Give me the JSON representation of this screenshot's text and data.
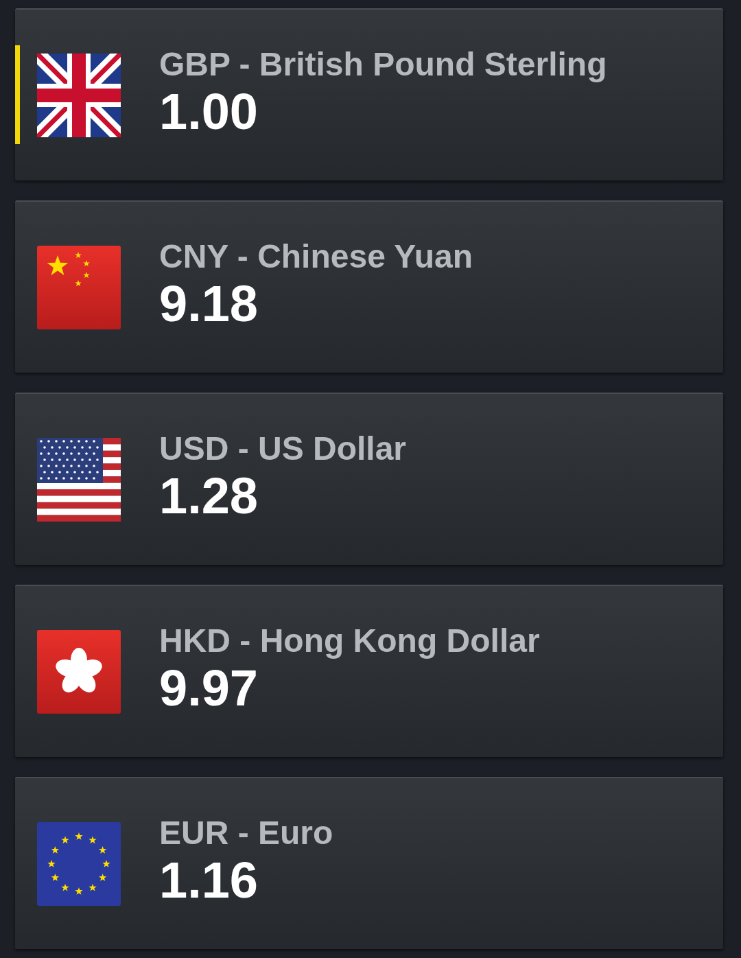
{
  "currencies": [
    {
      "kind": "uk",
      "name": "GBP - British Pound Sterling",
      "value": "1.00",
      "selected": true
    },
    {
      "kind": "china",
      "name": "CNY - Chinese Yuan",
      "value": "9.18",
      "selected": false
    },
    {
      "kind": "usa",
      "name": "USD - US Dollar",
      "value": "1.28",
      "selected": false
    },
    {
      "kind": "hongkong",
      "name": "HKD - Hong Kong Dollar",
      "value": "9.97",
      "selected": false
    },
    {
      "kind": "eu",
      "name": "EUR - Euro",
      "value": "1.16",
      "selected": false
    }
  ]
}
